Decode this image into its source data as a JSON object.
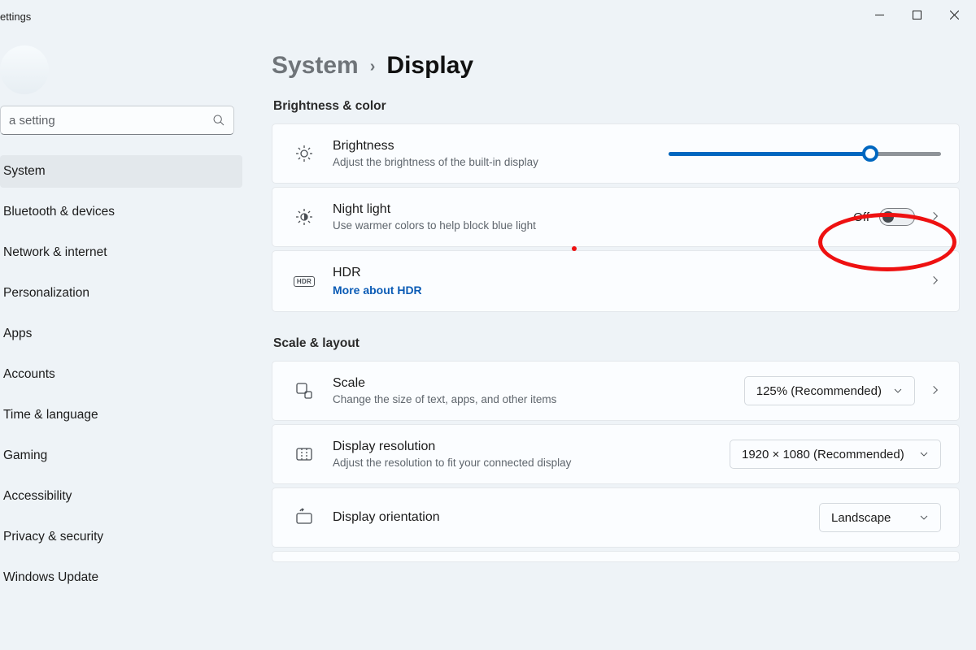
{
  "window": {
    "title": "ettings"
  },
  "search": {
    "placeholder": "a setting"
  },
  "sidebar": {
    "items": [
      {
        "label": "System"
      },
      {
        "label": "Bluetooth & devices"
      },
      {
        "label": "Network & internet"
      },
      {
        "label": "Personalization"
      },
      {
        "label": "Apps"
      },
      {
        "label": "Accounts"
      },
      {
        "label": "Time & language"
      },
      {
        "label": "Gaming"
      },
      {
        "label": "Accessibility"
      },
      {
        "label": "Privacy & security"
      },
      {
        "label": "Windows Update"
      }
    ]
  },
  "breadcrumb": {
    "parent": "System",
    "current": "Display"
  },
  "sections": {
    "brightness_color": {
      "header": "Brightness & color",
      "brightness": {
        "title": "Brightness",
        "sub": "Adjust the brightness of the built-in display",
        "value_pct": 74
      },
      "night_light": {
        "title": "Night light",
        "sub": "Use warmer colors to help block blue light",
        "state_label": "Off"
      },
      "hdr": {
        "title": "HDR",
        "link": "More about HDR",
        "badge": "HDR"
      }
    },
    "scale_layout": {
      "header": "Scale & layout",
      "scale": {
        "title": "Scale",
        "sub": "Change the size of text, apps, and other items",
        "value": "125% (Recommended)"
      },
      "resolution": {
        "title": "Display resolution",
        "sub": "Adjust the resolution to fit your connected display",
        "value": "1920 × 1080 (Recommended)"
      },
      "orientation": {
        "title": "Display orientation",
        "value": "Landscape"
      }
    }
  }
}
